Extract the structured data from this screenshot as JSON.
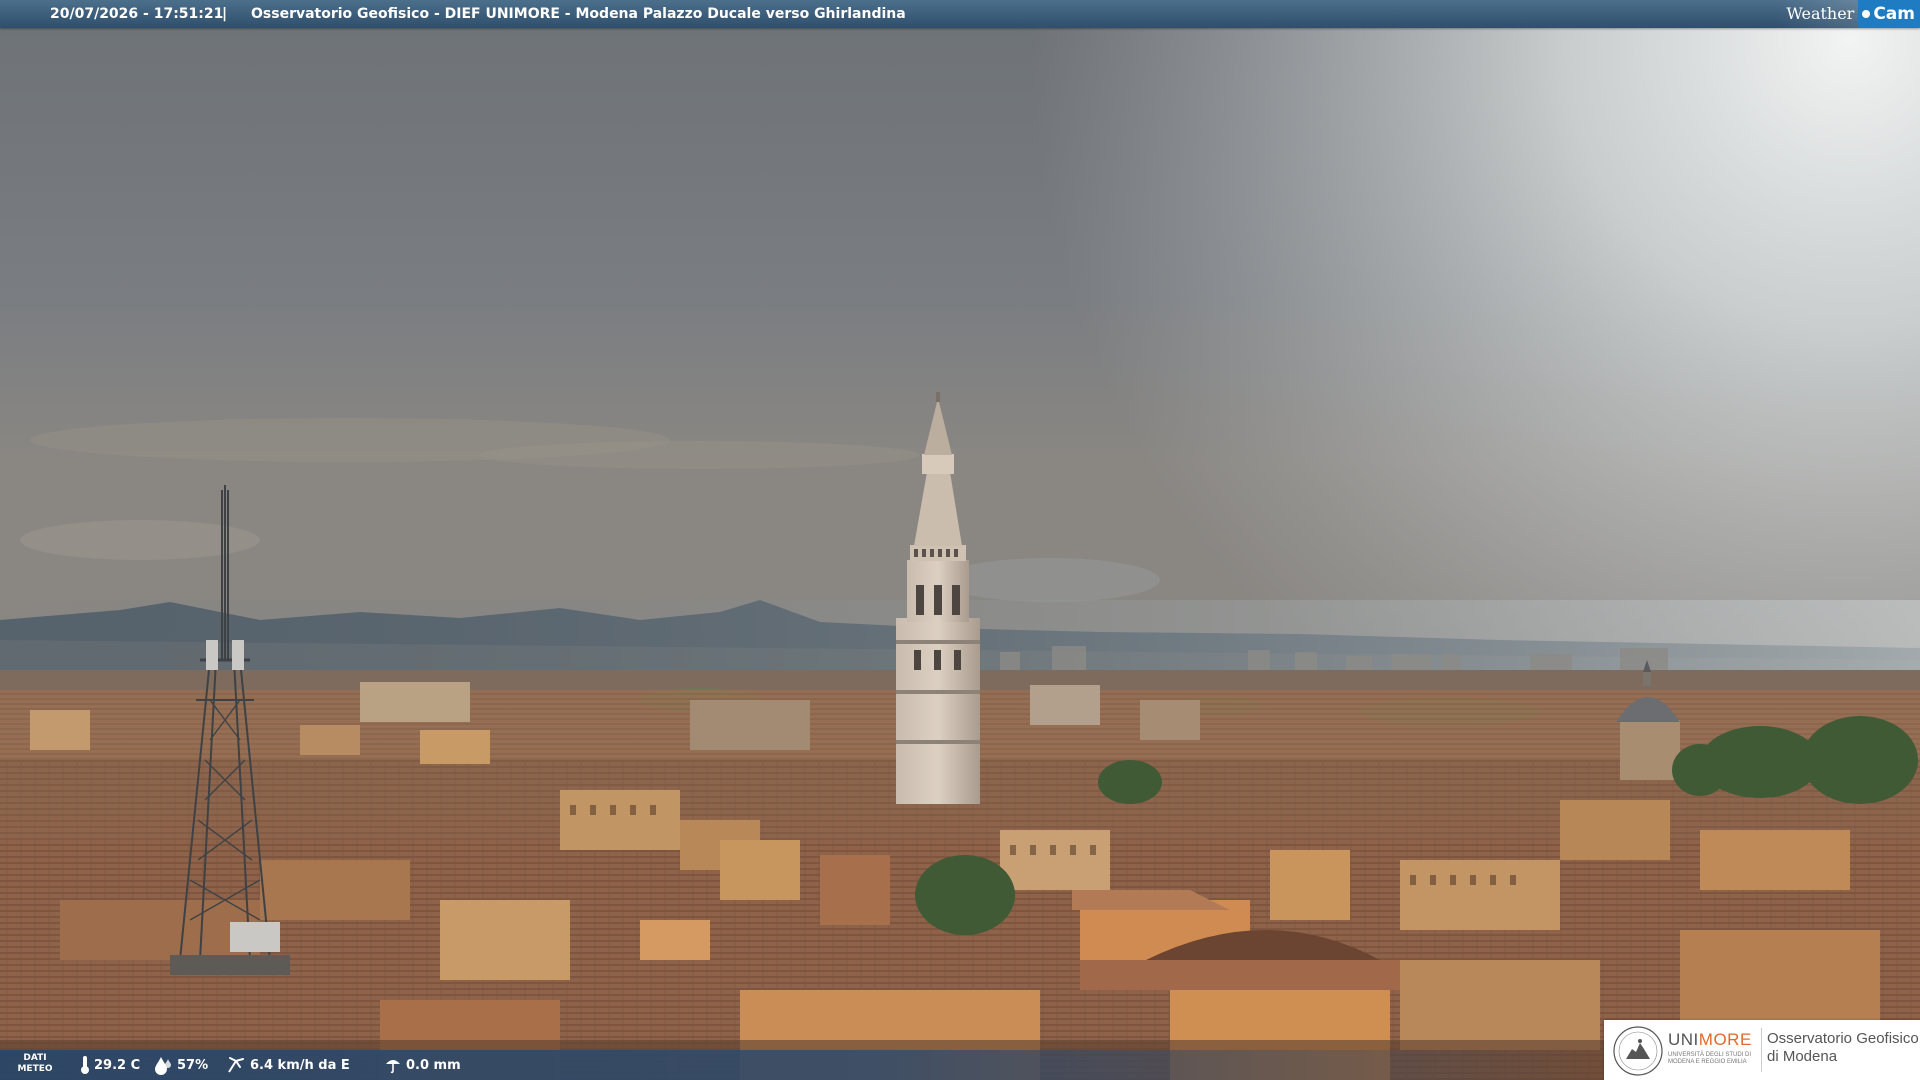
{
  "header": {
    "datetime": "20/07/2026 - 17:51:21",
    "separator": "|",
    "title": "Osservatorio Geofisico - DIEF UNIMORE - Modena Palazzo Ducale verso Ghirlandina",
    "logo_weather": "Weather",
    "logo_cam": "Cam"
  },
  "meteo": {
    "label_line1": "DATI",
    "label_line2": "METEO",
    "temperature": "29.2 C",
    "humidity": "57%",
    "wind": "6.4 km/h da E",
    "rain": "0.0 mm",
    "icons": [
      "thermometer-icon",
      "humidity-drop-icon",
      "wind-icon",
      "rain-gauge-icon"
    ]
  },
  "observatory": {
    "uni": "UNI",
    "more": "MORE",
    "university_line1": "UNIVERSITÀ DEGLI STUDI DI",
    "university_line2": "MODENA E REGGIO EMILIA",
    "name_line1": "Osservatorio Geofisico",
    "name_line2": "di Modena"
  },
  "colors": {
    "topbar": "#3d5f7e",
    "cam_badge": "#1f7cc2",
    "unimore_orange": "#e06a2a",
    "sky": "#7c8085",
    "roofs": "#9a6e52"
  }
}
